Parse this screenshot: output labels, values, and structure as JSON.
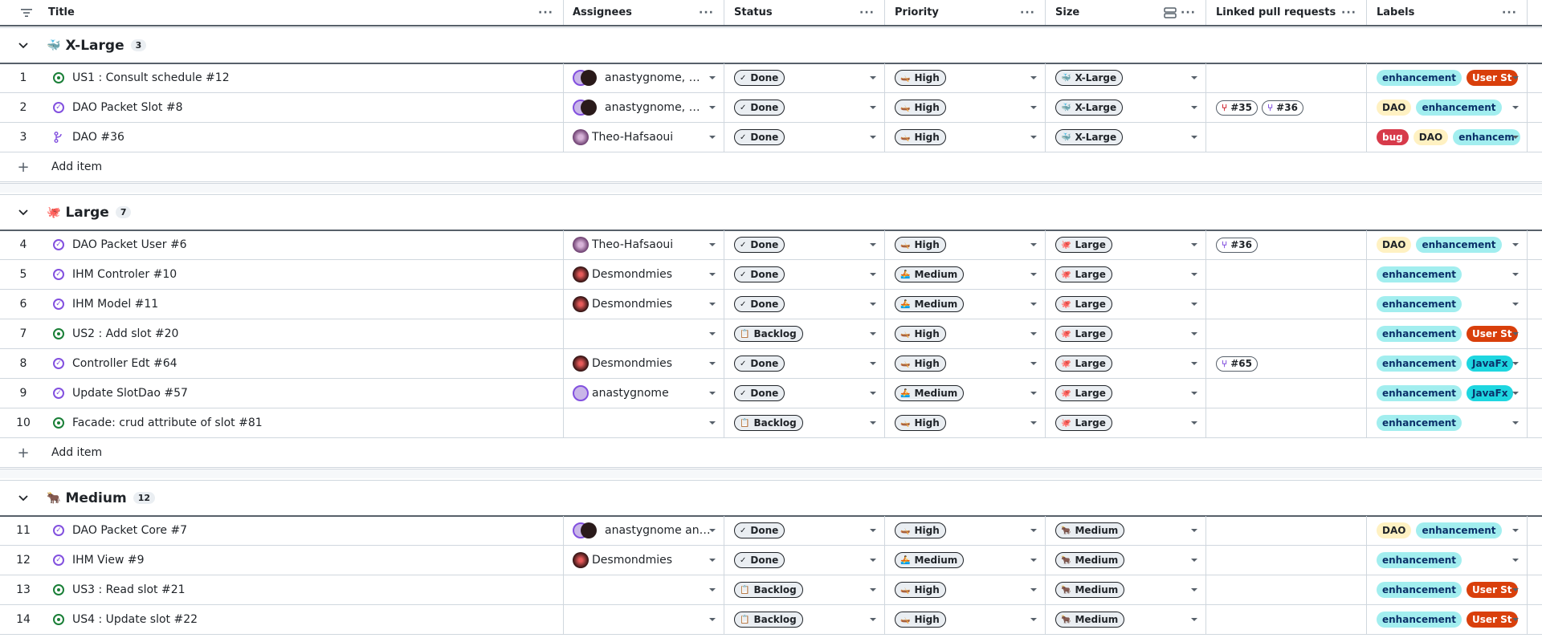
{
  "columns": {
    "title": "Title",
    "assignees": "Assignees",
    "status": "Status",
    "priority": "Priority",
    "size": "Size",
    "linked_prs": "Linked pull requests",
    "labels": "Labels"
  },
  "menu_dots": "···",
  "add_item": "Add item",
  "groups": [
    {
      "icon": "🐳",
      "name": "X-Large",
      "count": "3"
    },
    {
      "icon": "🐙",
      "name": "Large",
      "count": "7"
    },
    {
      "icon": "🐂",
      "name": "Medium",
      "count": "12"
    }
  ],
  "rows": [
    {
      "num": "1",
      "icon": "open",
      "title": "US1 : Consult schedule  #12",
      "assignee": "anastygnome, …",
      "avatar": "double",
      "status": "Done",
      "status_icon": "✓",
      "priority": "High",
      "priority_icon": "🛶",
      "size": "X-Large",
      "size_icon": "🐳",
      "prs": [],
      "labels": [
        "enhancement",
        "User St"
      ]
    },
    {
      "num": "2",
      "icon": "done",
      "title": "DAO Packet Slot  #8",
      "assignee": "anastygnome, …",
      "avatar": "double",
      "status": "Done",
      "status_icon": "✓",
      "priority": "High",
      "priority_icon": "🛶",
      "size": "X-Large",
      "size_icon": "🐳",
      "prs": [
        {
          "num": "#35",
          "closed": true
        },
        {
          "num": "#36",
          "closed": false
        }
      ],
      "labels": [
        "DAO",
        "enhancement"
      ]
    },
    {
      "num": "3",
      "icon": "pr",
      "title": "DAO  #36",
      "assignee": "Theo-Hafsaoui",
      "avatar": "theo",
      "status": "Done",
      "status_icon": "✓",
      "priority": "High",
      "priority_icon": "🛶",
      "size": "X-Large",
      "size_icon": "🐳",
      "prs": [],
      "labels": [
        "bug",
        "DAO",
        "enhancem"
      ]
    },
    {
      "num": "4",
      "icon": "done",
      "title": "DAO Packet User  #6",
      "assignee": "Theo-Hafsaoui",
      "avatar": "theo",
      "status": "Done",
      "status_icon": "✓",
      "priority": "High",
      "priority_icon": "🛶",
      "size": "Large",
      "size_icon": "🐙",
      "prs": [
        {
          "num": "#36",
          "closed": false
        }
      ],
      "labels": [
        "DAO",
        "enhancement"
      ]
    },
    {
      "num": "5",
      "icon": "done",
      "title": "IHM Controler  #10",
      "assignee": "Desmondmies",
      "avatar": "desm",
      "status": "Done",
      "status_icon": "✓",
      "priority": "Medium",
      "priority_icon": "🚣",
      "size": "Large",
      "size_icon": "🐙",
      "prs": [],
      "labels": [
        "enhancement"
      ]
    },
    {
      "num": "6",
      "icon": "done",
      "title": "IHM Model  #11",
      "assignee": "Desmondmies",
      "avatar": "desm",
      "status": "Done",
      "status_icon": "✓",
      "priority": "Medium",
      "priority_icon": "🚣",
      "size": "Large",
      "size_icon": "🐙",
      "prs": [],
      "labels": [
        "enhancement"
      ]
    },
    {
      "num": "7",
      "icon": "open",
      "title": "US2 : Add slot  #20",
      "assignee": "",
      "avatar": "none",
      "status": "Backlog",
      "status_icon": "📋",
      "priority": "High",
      "priority_icon": "🛶",
      "size": "Large",
      "size_icon": "🐙",
      "prs": [],
      "labels": [
        "enhancement",
        "User St"
      ]
    },
    {
      "num": "8",
      "icon": "done",
      "title": "Controller Edt  #64",
      "assignee": "Desmondmies",
      "avatar": "desm",
      "status": "Done",
      "status_icon": "✓",
      "priority": "High",
      "priority_icon": "🛶",
      "size": "Large",
      "size_icon": "🐙",
      "prs": [
        {
          "num": "#65",
          "closed": false
        }
      ],
      "labels": [
        "enhancement",
        "JavaFx"
      ]
    },
    {
      "num": "9",
      "icon": "done",
      "title": "Update SlotDao  #57",
      "assignee": "anastygnome",
      "avatar": "anast",
      "status": "Done",
      "status_icon": "✓",
      "priority": "Medium",
      "priority_icon": "🚣",
      "size": "Large",
      "size_icon": "🐙",
      "prs": [],
      "labels": [
        "enhancement",
        "JavaFx"
      ]
    },
    {
      "num": "10",
      "icon": "open",
      "title": "Facade: crud attribute of slot  #81",
      "assignee": "",
      "avatar": "none",
      "status": "Backlog",
      "status_icon": "📋",
      "priority": "High",
      "priority_icon": "🛶",
      "size": "Large",
      "size_icon": "🐙",
      "prs": [],
      "labels": [
        "enhancement"
      ]
    },
    {
      "num": "11",
      "icon": "done",
      "title": "DAO Packet Core  #7",
      "assignee": "anastygnome an…",
      "avatar": "double",
      "status": "Done",
      "status_icon": "✓",
      "priority": "High",
      "priority_icon": "🛶",
      "size": "Medium",
      "size_icon": "🐂",
      "prs": [],
      "labels": [
        "DAO",
        "enhancement"
      ]
    },
    {
      "num": "12",
      "icon": "done",
      "title": "IHM View  #9",
      "assignee": "Desmondmies",
      "avatar": "desm",
      "status": "Done",
      "status_icon": "✓",
      "priority": "Medium",
      "priority_icon": "🚣",
      "size": "Medium",
      "size_icon": "🐂",
      "prs": [],
      "labels": [
        "enhancement"
      ]
    },
    {
      "num": "13",
      "icon": "open",
      "title": "US3 : Read slot  #21",
      "assignee": "",
      "avatar": "none",
      "status": "Backlog",
      "status_icon": "📋",
      "priority": "High",
      "priority_icon": "🛶",
      "size": "Medium",
      "size_icon": "🐂",
      "prs": [],
      "labels": [
        "enhancement",
        "User St"
      ]
    },
    {
      "num": "14",
      "icon": "open",
      "title": "US4 : Update slot  #22",
      "assignee": "",
      "avatar": "none",
      "status": "Backlog",
      "status_icon": "📋",
      "priority": "High",
      "priority_icon": "🛶",
      "size": "Medium",
      "size_icon": "🐂",
      "prs": [],
      "labels": [
        "enhancement",
        "User St"
      ]
    }
  ]
}
